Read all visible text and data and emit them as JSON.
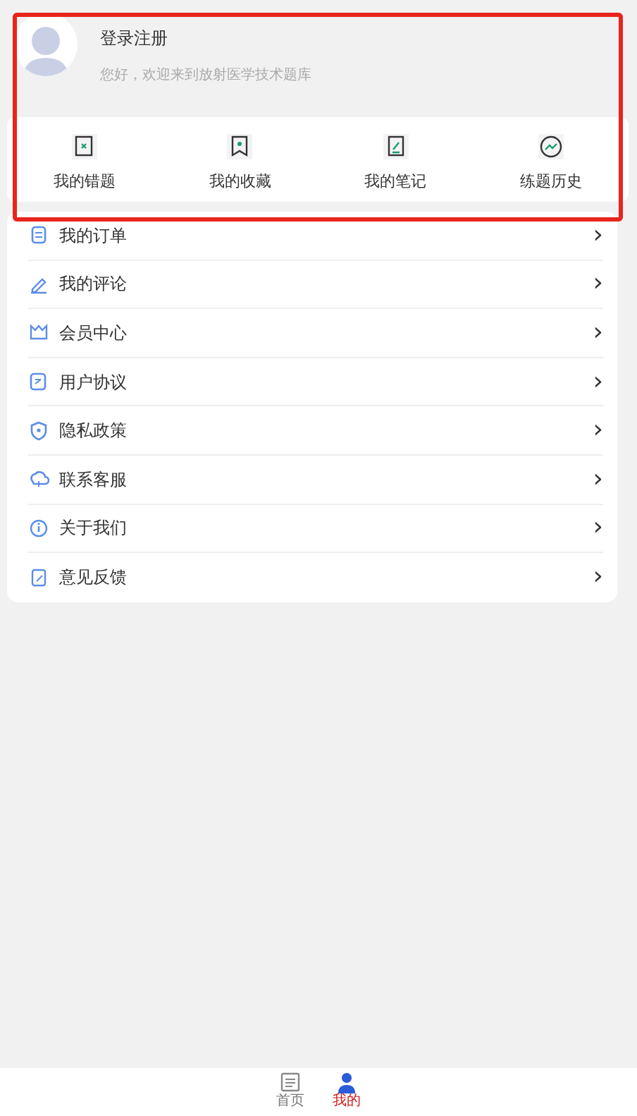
{
  "profile": {
    "title": "登录注册",
    "subtitle": "您好，欢迎来到放射医学技术题库"
  },
  "shortcuts": [
    {
      "label": "我的错题"
    },
    {
      "label": "我的收藏"
    },
    {
      "label": "我的笔记"
    },
    {
      "label": "练题历史"
    }
  ],
  "menu": [
    {
      "label": "我的订单",
      "chevron": "›"
    },
    {
      "label": "我的评论",
      "chevron": "›"
    },
    {
      "label": "会员中心",
      "chevron": "›"
    },
    {
      "label": "用户协议",
      "chevron": "›"
    },
    {
      "label": "隐私政策",
      "chevron": "›"
    },
    {
      "label": "联系客服",
      "chevron": "›"
    },
    {
      "label": "关于我们",
      "chevron": "›"
    },
    {
      "label": "意见反馈",
      "chevron": "›"
    }
  ],
  "tab_bar": [
    {
      "label": "首页",
      "selected": false
    },
    {
      "label": "我的",
      "selected": true
    }
  ]
}
